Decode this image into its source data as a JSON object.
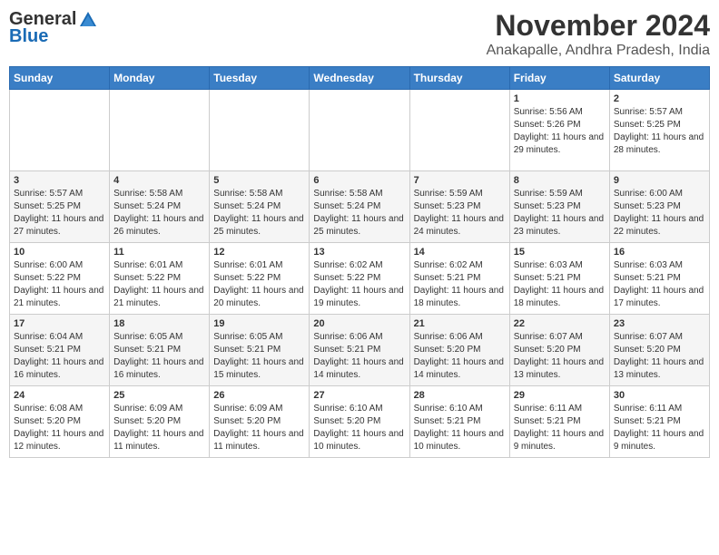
{
  "header": {
    "logo_general": "General",
    "logo_blue": "Blue",
    "month": "November 2024",
    "location": "Anakapalle, Andhra Pradesh, India"
  },
  "weekdays": [
    "Sunday",
    "Monday",
    "Tuesday",
    "Wednesday",
    "Thursday",
    "Friday",
    "Saturday"
  ],
  "weeks": [
    [
      {
        "day": "",
        "info": ""
      },
      {
        "day": "",
        "info": ""
      },
      {
        "day": "",
        "info": ""
      },
      {
        "day": "",
        "info": ""
      },
      {
        "day": "",
        "info": ""
      },
      {
        "day": "1",
        "info": "Sunrise: 5:56 AM\nSunset: 5:26 PM\nDaylight: 11 hours and 29 minutes."
      },
      {
        "day": "2",
        "info": "Sunrise: 5:57 AM\nSunset: 5:25 PM\nDaylight: 11 hours and 28 minutes."
      }
    ],
    [
      {
        "day": "3",
        "info": "Sunrise: 5:57 AM\nSunset: 5:25 PM\nDaylight: 11 hours and 27 minutes."
      },
      {
        "day": "4",
        "info": "Sunrise: 5:58 AM\nSunset: 5:24 PM\nDaylight: 11 hours and 26 minutes."
      },
      {
        "day": "5",
        "info": "Sunrise: 5:58 AM\nSunset: 5:24 PM\nDaylight: 11 hours and 25 minutes."
      },
      {
        "day": "6",
        "info": "Sunrise: 5:58 AM\nSunset: 5:24 PM\nDaylight: 11 hours and 25 minutes."
      },
      {
        "day": "7",
        "info": "Sunrise: 5:59 AM\nSunset: 5:23 PM\nDaylight: 11 hours and 24 minutes."
      },
      {
        "day": "8",
        "info": "Sunrise: 5:59 AM\nSunset: 5:23 PM\nDaylight: 11 hours and 23 minutes."
      },
      {
        "day": "9",
        "info": "Sunrise: 6:00 AM\nSunset: 5:23 PM\nDaylight: 11 hours and 22 minutes."
      }
    ],
    [
      {
        "day": "10",
        "info": "Sunrise: 6:00 AM\nSunset: 5:22 PM\nDaylight: 11 hours and 21 minutes."
      },
      {
        "day": "11",
        "info": "Sunrise: 6:01 AM\nSunset: 5:22 PM\nDaylight: 11 hours and 21 minutes."
      },
      {
        "day": "12",
        "info": "Sunrise: 6:01 AM\nSunset: 5:22 PM\nDaylight: 11 hours and 20 minutes."
      },
      {
        "day": "13",
        "info": "Sunrise: 6:02 AM\nSunset: 5:22 PM\nDaylight: 11 hours and 19 minutes."
      },
      {
        "day": "14",
        "info": "Sunrise: 6:02 AM\nSunset: 5:21 PM\nDaylight: 11 hours and 18 minutes."
      },
      {
        "day": "15",
        "info": "Sunrise: 6:03 AM\nSunset: 5:21 PM\nDaylight: 11 hours and 18 minutes."
      },
      {
        "day": "16",
        "info": "Sunrise: 6:03 AM\nSunset: 5:21 PM\nDaylight: 11 hours and 17 minutes."
      }
    ],
    [
      {
        "day": "17",
        "info": "Sunrise: 6:04 AM\nSunset: 5:21 PM\nDaylight: 11 hours and 16 minutes."
      },
      {
        "day": "18",
        "info": "Sunrise: 6:05 AM\nSunset: 5:21 PM\nDaylight: 11 hours and 16 minutes."
      },
      {
        "day": "19",
        "info": "Sunrise: 6:05 AM\nSunset: 5:21 PM\nDaylight: 11 hours and 15 minutes."
      },
      {
        "day": "20",
        "info": "Sunrise: 6:06 AM\nSunset: 5:21 PM\nDaylight: 11 hours and 14 minutes."
      },
      {
        "day": "21",
        "info": "Sunrise: 6:06 AM\nSunset: 5:20 PM\nDaylight: 11 hours and 14 minutes."
      },
      {
        "day": "22",
        "info": "Sunrise: 6:07 AM\nSunset: 5:20 PM\nDaylight: 11 hours and 13 minutes."
      },
      {
        "day": "23",
        "info": "Sunrise: 6:07 AM\nSunset: 5:20 PM\nDaylight: 11 hours and 13 minutes."
      }
    ],
    [
      {
        "day": "24",
        "info": "Sunrise: 6:08 AM\nSunset: 5:20 PM\nDaylight: 11 hours and 12 minutes."
      },
      {
        "day": "25",
        "info": "Sunrise: 6:09 AM\nSunset: 5:20 PM\nDaylight: 11 hours and 11 minutes."
      },
      {
        "day": "26",
        "info": "Sunrise: 6:09 AM\nSunset: 5:20 PM\nDaylight: 11 hours and 11 minutes."
      },
      {
        "day": "27",
        "info": "Sunrise: 6:10 AM\nSunset: 5:20 PM\nDaylight: 11 hours and 10 minutes."
      },
      {
        "day": "28",
        "info": "Sunrise: 6:10 AM\nSunset: 5:21 PM\nDaylight: 11 hours and 10 minutes."
      },
      {
        "day": "29",
        "info": "Sunrise: 6:11 AM\nSunset: 5:21 PM\nDaylight: 11 hours and 9 minutes."
      },
      {
        "day": "30",
        "info": "Sunrise: 6:11 AM\nSunset: 5:21 PM\nDaylight: 11 hours and 9 minutes."
      }
    ]
  ]
}
